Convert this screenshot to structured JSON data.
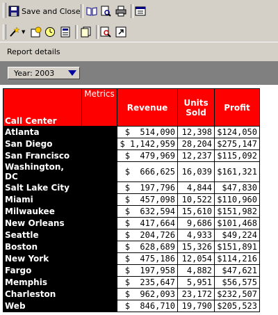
{
  "toolbar": {
    "save_close_label": "Save and Close"
  },
  "details": {
    "label": "Report details"
  },
  "page_by": {
    "selected": "Year: 2003"
  },
  "grid": {
    "header_row_label": "Call Center",
    "metrics_label": "Metrics",
    "columns": [
      "Revenue",
      "Units Sold",
      "Profit"
    ],
    "columns_line2": [
      "",
      "Sold",
      ""
    ],
    "rows": [
      {
        "city": "Atlanta",
        "revenue": "$  514,090",
        "units": "12,398",
        "profit": "$124,050"
      },
      {
        "city": "San Diego",
        "revenue": "$ 1,142,959",
        "units": "28,204",
        "profit": "$275,147"
      },
      {
        "city": "San Francisco",
        "revenue": "$  479,969",
        "units": "12,237",
        "profit": "$115,092"
      },
      {
        "city": "Washington, DC",
        "revenue": "$  666,625",
        "units": "16,039",
        "profit": "$161,321"
      },
      {
        "city": "Salt Lake City",
        "revenue": "$  197,796",
        "units": "4,844",
        "profit": "$47,830"
      },
      {
        "city": "Miami",
        "revenue": "$  457,098",
        "units": "10,522",
        "profit": "$110,960"
      },
      {
        "city": "Milwaukee",
        "revenue": "$  632,594",
        "units": "15,610",
        "profit": "$151,982"
      },
      {
        "city": "New Orleans",
        "revenue": "$  417,664",
        "units": "9,686",
        "profit": "$101,468"
      },
      {
        "city": "Seattle",
        "revenue": "$  204,726",
        "units": "4,933",
        "profit": "$49,224"
      },
      {
        "city": "Boston",
        "revenue": "$  628,689",
        "units": "15,326",
        "profit": "$151,891"
      },
      {
        "city": "New York",
        "revenue": "$  475,186",
        "units": "12,054",
        "profit": "$114,216"
      },
      {
        "city": "Fargo",
        "revenue": "$  197,958",
        "units": "4,882",
        "profit": "$47,621"
      },
      {
        "city": "Memphis",
        "revenue": "$  235,647",
        "units": "5,951",
        "profit": "$56,575"
      },
      {
        "city": "Charleston",
        "revenue": "$  962,093",
        "units": "23,172",
        "profit": "$232,507"
      },
      {
        "city": "Web",
        "revenue": "$  846,710",
        "units": "19,790",
        "profit": "$205,523"
      }
    ]
  },
  "colors": {
    "header_red": "#ff0000",
    "row_header_black": "#000000",
    "chrome": "#d4d0c8"
  }
}
